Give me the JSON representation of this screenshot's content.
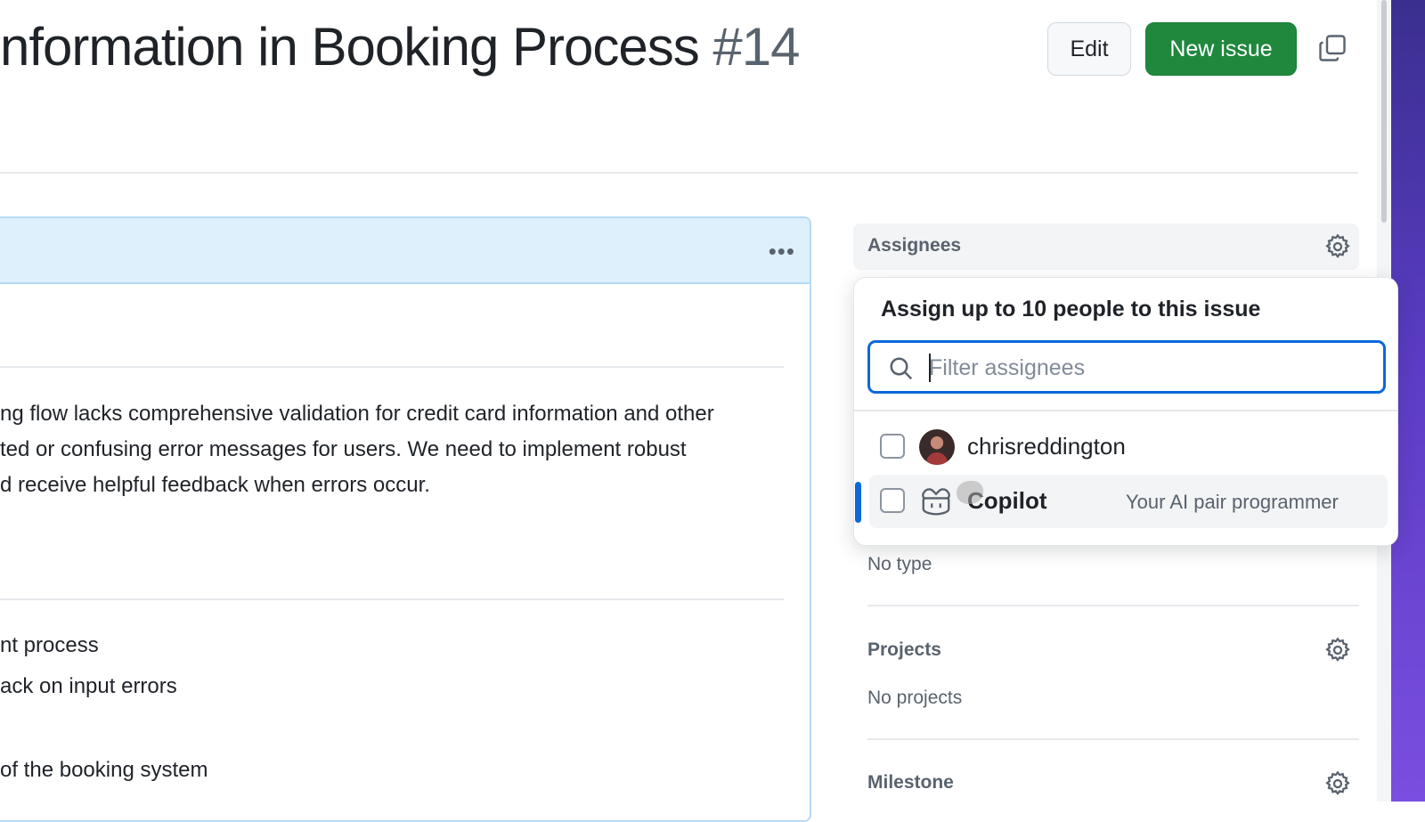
{
  "header": {
    "title": "nformation in Booking Process",
    "issue_number": "#14",
    "edit_label": "Edit",
    "new_issue_label": "New issue"
  },
  "comment": {
    "menu_label": "•••",
    "lines": [
      "ng flow lacks comprehensive validation for credit card information and other",
      "ted or confusing error messages for users. We need to implement robust",
      "d receive helpful feedback when errors occur.",
      "nt process",
      "ack on input errors",
      "of the booking system"
    ]
  },
  "sidebar": {
    "assignees_label": "Assignees",
    "type_value": "No type",
    "projects_label": "Projects",
    "projects_value": "No projects",
    "milestone_label": "Milestone"
  },
  "assignee_popover": {
    "title": "Assign up to 10 people to this issue",
    "search_placeholder": "Filter assignees",
    "search_value": "",
    "items": [
      {
        "name": "chrisreddington",
        "description": "",
        "checked": false
      },
      {
        "name": "Copilot",
        "description": "Your AI pair programmer",
        "checked": false
      }
    ]
  },
  "colors": {
    "primary_button": "#1f883d",
    "focus_border": "#0969da",
    "comment_header": "#ddf0fc"
  }
}
